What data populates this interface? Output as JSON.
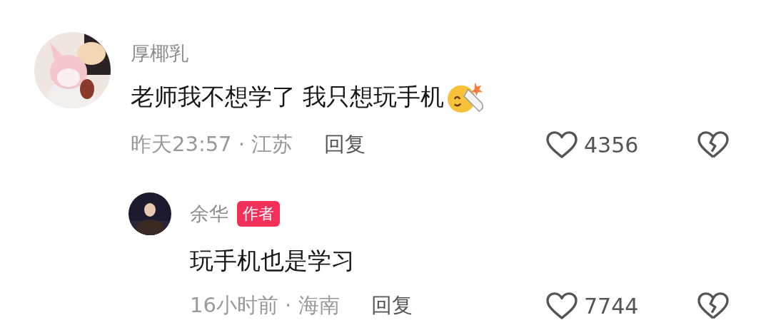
{
  "comments": [
    {
      "author": "厚椰乳",
      "text": "老师我不想学了 我只想玩手机",
      "emoji": true,
      "time": "昨天23:57 · 江苏",
      "reply_label": "回复",
      "likes": "4356",
      "replies": [
        {
          "author": "余华",
          "badge": "作者",
          "text": "玩手机也是学习",
          "time": "16小时前 · 海南",
          "reply_label": "回复",
          "likes": "7744"
        }
      ]
    }
  ]
}
